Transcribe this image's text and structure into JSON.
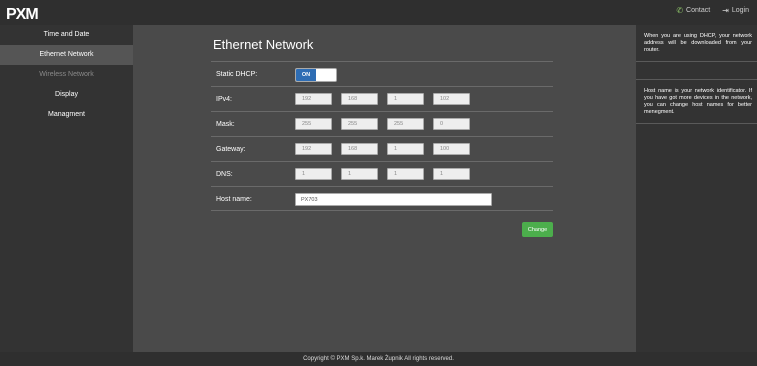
{
  "header": {
    "logo_text": "PXM",
    "contact_label": "Contact",
    "login_label": "Login",
    "contact_icon": "phone-icon",
    "login_icon": "login-icon"
  },
  "sidebar": {
    "items": [
      {
        "label": "Time and Date"
      },
      {
        "label": "Ethernet Network"
      },
      {
        "label": "Wireless Network"
      },
      {
        "label": "Display"
      },
      {
        "label": "Managment"
      }
    ]
  },
  "main": {
    "title": "Ethernet Network",
    "static_dhcp": {
      "label": "Static DHCP:",
      "value": "ON"
    },
    "ipv4": {
      "label": "IPv4:",
      "octets": [
        "192",
        "168",
        "1",
        "102"
      ]
    },
    "mask": {
      "label": "Mask:",
      "octets": [
        "255",
        "255",
        "255",
        "0"
      ]
    },
    "gateway": {
      "label": "Gateway:",
      "octets": [
        "192",
        "168",
        "1",
        "100"
      ]
    },
    "dns": {
      "label": "DNS:",
      "octets": [
        "1",
        "1",
        "1",
        "1"
      ]
    },
    "host_name": {
      "label": "Host name:",
      "value": "PX703"
    },
    "change_label": "Change"
  },
  "info": {
    "dhcp_text": "When you are using DHCP, your network address will be downloaded from your router.",
    "host_text": "Host name is your network identificator. If you have got more devices in the network, you can change host names for better menegment."
  },
  "footer": {
    "copyright": "Copyright © PXM Sp.k. Marek Żupnik All rights reserved."
  },
  "colors": {
    "accent_green": "#4cae4c",
    "toggle_blue": "#2e6db4",
    "background": "#4a4a4a",
    "panel": "#333333"
  }
}
